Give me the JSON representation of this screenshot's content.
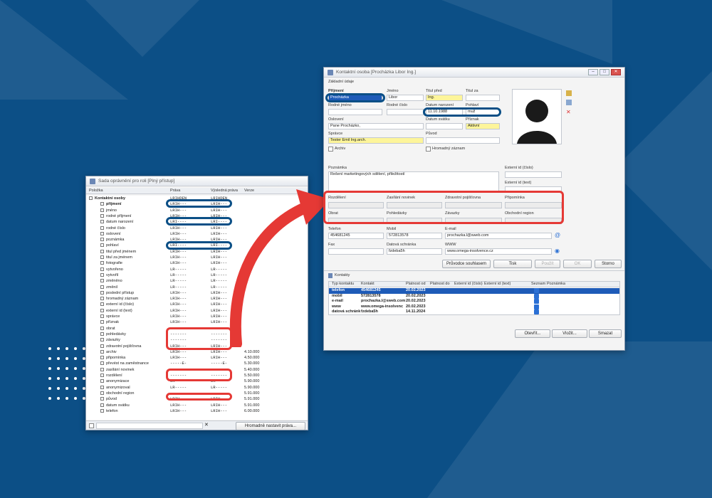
{
  "left_window": {
    "title": "Sada oprávnění pro roli [Plný přístup]",
    "columns": [
      "Položka",
      "Práva",
      "Výsledná práva",
      "Verze"
    ],
    "rows": [
      {
        "name": "Kontaktní osoby",
        "rights": "LRIHDEN",
        "result": "LRIHDEN",
        "version": "",
        "root": true
      },
      {
        "name": "příjmení",
        "rights": "LRIH---",
        "result": "LRIH---",
        "version": ""
      },
      {
        "name": "jméno",
        "rights": "LRIH---",
        "result": "LRIH---",
        "version": ""
      },
      {
        "name": "rodné příjmení",
        "rights": "LRIH---",
        "result": "LRIH---",
        "version": ""
      },
      {
        "name": "datum narození",
        "rights": "LRI----",
        "result": "LRI----",
        "version": ""
      },
      {
        "name": "rodné číslo",
        "rights": "LRIH---",
        "result": "LRIH---",
        "version": ""
      },
      {
        "name": "oslovení",
        "rights": "LRIH---",
        "result": "LRIH---",
        "version": ""
      },
      {
        "name": "poznámka",
        "rights": "LRIH---",
        "result": "LRIH---",
        "version": ""
      },
      {
        "name": "pohlaví",
        "rights": "LRI----",
        "result": "LRI----",
        "version": ""
      },
      {
        "name": "titul před jménem",
        "rights": "LRIH---",
        "result": "LRIH---",
        "version": ""
      },
      {
        "name": "titul za jménem",
        "rights": "LRIH---",
        "result": "LRIH---",
        "version": ""
      },
      {
        "name": "fotografie",
        "rights": "LRIH---",
        "result": "LRIH---",
        "version": ""
      },
      {
        "name": "vytvořeno",
        "rights": "LR-----",
        "result": "LR-----",
        "version": ""
      },
      {
        "name": "vytvořil",
        "rights": "LR-----",
        "result": "LR-----",
        "version": ""
      },
      {
        "name": "změněno",
        "rights": "LR-----",
        "result": "LR-----",
        "version": ""
      },
      {
        "name": "změnil",
        "rights": "LR-----",
        "result": "LR-----",
        "version": ""
      },
      {
        "name": "poslední přístup",
        "rights": "LRIH---",
        "result": "LRIH---",
        "version": ""
      },
      {
        "name": "hromadný záznam",
        "rights": "LRIH---",
        "result": "LRIH---",
        "version": ""
      },
      {
        "name": "externí id (číslo)",
        "rights": "LRIH---",
        "result": "LRIH---",
        "version": ""
      },
      {
        "name": "externí id (text)",
        "rights": "LRIH---",
        "result": "LRIH---",
        "version": ""
      },
      {
        "name": "správce",
        "rights": "LRIH---",
        "result": "LRIH---",
        "version": ""
      },
      {
        "name": "příznak",
        "rights": "LRIH---",
        "result": "LRIH---",
        "version": ""
      },
      {
        "name": "obrat",
        "rights": "-------",
        "result": "-------",
        "version": ""
      },
      {
        "name": "pohledávky",
        "rights": "-------",
        "result": "-------",
        "version": ""
      },
      {
        "name": "závazky",
        "rights": "-------",
        "result": "-------",
        "version": ""
      },
      {
        "name": "zdravotní pojišťovna",
        "rights": "LRIH---",
        "result": "LRIH---",
        "version": ""
      },
      {
        "name": "archiv",
        "rights": "LRIH---",
        "result": "LRIH---",
        "version": "4.10.000"
      },
      {
        "name": "připomínka",
        "rights": "LRIH---",
        "result": "LRIH---",
        "version": "4.50.000"
      },
      {
        "name": "převést na zaměstnance",
        "rights": "-----E-",
        "result": "-----E-",
        "version": "5.30.000"
      },
      {
        "name": "zasílání novinek",
        "rights": "-------",
        "result": "-------",
        "version": "5.40.000"
      },
      {
        "name": "rozdělení",
        "rights": "-------",
        "result": "-------",
        "version": "5.50.000"
      },
      {
        "name": "anonymizace",
        "rights": "LR-----",
        "result": "LR-----",
        "version": "5.90.000"
      },
      {
        "name": "anonymizoval",
        "rights": "LR-----",
        "result": "LR-----",
        "version": "5.90.000"
      },
      {
        "name": "obchodní region",
        "rights": "-------",
        "result": "-------",
        "version": "5.91.000"
      },
      {
        "name": "původ",
        "rights": "LRIH---",
        "result": "LRIH---",
        "version": "5.91.000"
      },
      {
        "name": "datum svátku",
        "rights": "LRIH---",
        "result": "LRIH---",
        "version": "5.91.000"
      },
      {
        "name": "telefon",
        "rights": "LRIH---",
        "result": "LRIH---",
        "version": "6.00.000"
      }
    ],
    "bulk_button": "Hromadně nastavit práva..."
  },
  "right_window": {
    "title": "Kontaktní osoba [Procházka Libor Ing.]",
    "section_title": "Základní údaje",
    "fields": {
      "surname_label": "Příjmení",
      "surname": "Procházka",
      "firstname_label": "Jméno",
      "firstname": "Libor",
      "title_before_label": "Titul před",
      "title_before": "Ing.",
      "title_after_label": "Titul za",
      "title_after": "",
      "birth_surname_label": "Rodné jméno",
      "birth_surname": "",
      "birth_number_label": "Rodné číslo",
      "birth_number": "",
      "birth_date_label": "Datum narození",
      "birth_date": "11.10.1988",
      "gender_label": "Pohlaví",
      "gender": "muž",
      "salutation_label": "Oslovení",
      "salutation": "Pane Procházko,",
      "nameday_label": "Datum svátku",
      "nameday": "",
      "flag_label": "Příznak",
      "flag": "Aktivní",
      "manager_label": "Správce",
      "manager": "Tester Emil Ing.arch.",
      "origin_label": "Původ",
      "origin": "",
      "archive_label": "Archiv",
      "bulk_record_label": "Hromadný záznam",
      "note_label": "Poznámka",
      "note": "Řešení marketingových sdělení, přiležitostí",
      "ext_id_num_label": "Externí id (číslo)",
      "ext_id_text_label": "Externí id (text)",
      "distribution_label": "Rozdělení",
      "newsletter_label": "Zasílání novinek",
      "insurance_label": "Zdravotní pojišťovna",
      "reminder_label": "Připomínka",
      "turnover_label": "Obrat",
      "receivables_label": "Pohledávky",
      "liabilities_label": "Závazky",
      "region_label": "Obchodní region",
      "phone_label": "Telefon",
      "phone": "454681245",
      "mobile_label": "Mobil",
      "mobile": "572813578",
      "email_label": "E-mail",
      "email": "prochazka.l@sweb.com",
      "fax_label": "Fax",
      "fax": "",
      "databox_label": "Datová schránka",
      "databox": "fzdeba5h",
      "www_label": "WWW",
      "www": "www.omega-insolvence.cz"
    },
    "buttons": {
      "consent": "Průvodce souhlasem",
      "print": "Tisk",
      "apply": "Použít",
      "ok": "OK",
      "cancel": "Storno",
      "open": "Otevřít...",
      "insert": "Vložit...",
      "delete": "Smazat"
    },
    "contacts": {
      "title": "Kontakty",
      "headers": [
        "Typ kontaktu",
        "Kontakt",
        "Platnost od",
        "Platnost do",
        "Externí id (číslo)",
        "Externí id (text)",
        "Seznam",
        "Poznámka"
      ],
      "rows": [
        {
          "type": "telefon",
          "contact": "454681245",
          "from": "20.02.2023"
        },
        {
          "type": "mobil",
          "contact": "572813578",
          "from": "20.02.2023"
        },
        {
          "type": "e-mail",
          "contact": "prochazka.l@sweb.com",
          "from": "20.02.2023"
        },
        {
          "type": "www",
          "contact": "www.omega-insolvenc",
          "from": "20.02.2023"
        },
        {
          "type": "datová schránka",
          "contact": "fzdeba5h",
          "from": "14.11.2024"
        }
      ]
    }
  }
}
